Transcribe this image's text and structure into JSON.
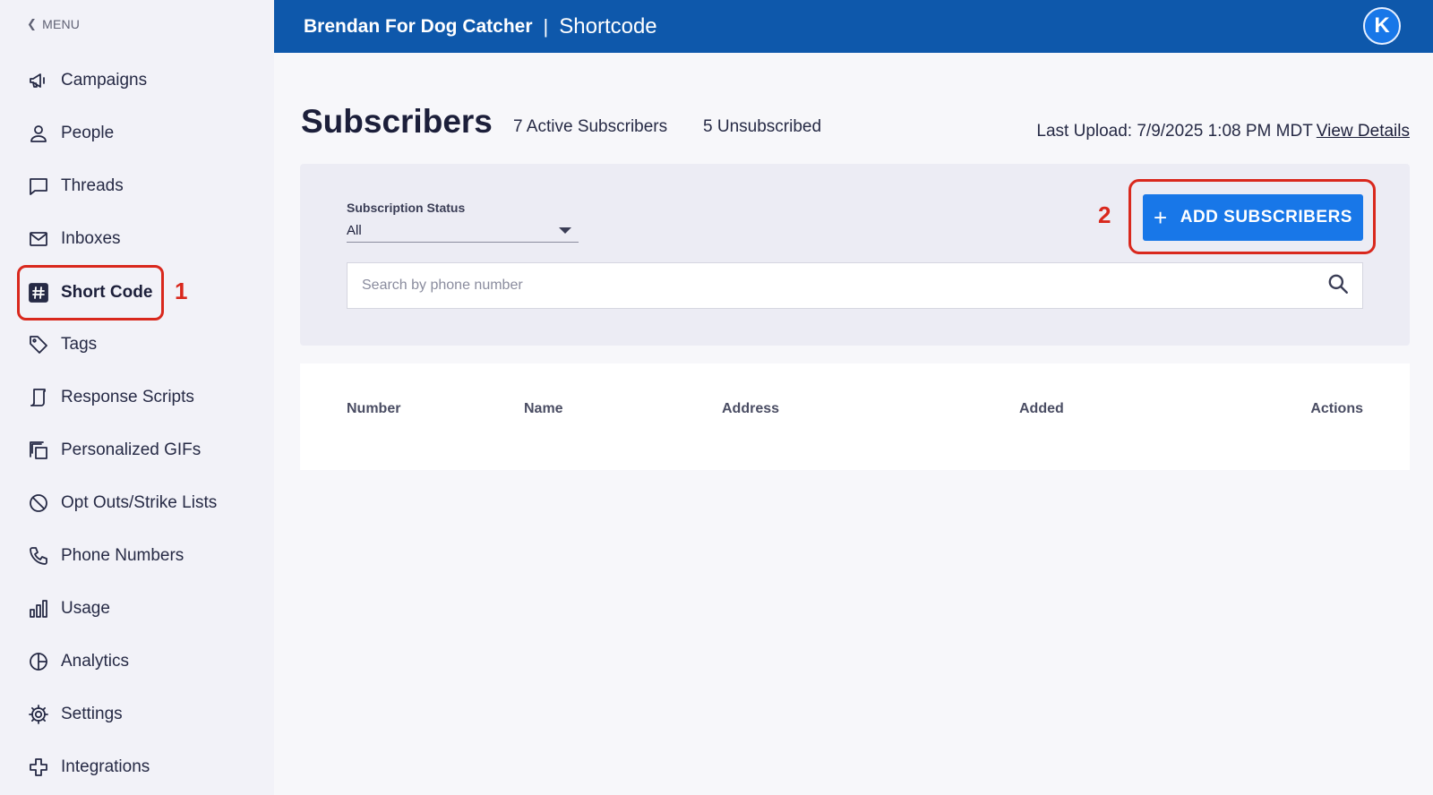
{
  "sidebar": {
    "back_label": "MENU",
    "items": [
      {
        "label": "Campaigns",
        "icon": "megaphone-icon"
      },
      {
        "label": "People",
        "icon": "person-icon"
      },
      {
        "label": "Threads",
        "icon": "chat-icon"
      },
      {
        "label": "Inboxes",
        "icon": "envelope-icon"
      },
      {
        "label": "Short Code",
        "icon": "hash-icon",
        "active": true
      },
      {
        "label": "Tags",
        "icon": "tag-icon"
      },
      {
        "label": "Response Scripts",
        "icon": "script-icon"
      },
      {
        "label": "Personalized GIFs",
        "icon": "copy-icon"
      },
      {
        "label": "Opt Outs/Strike Lists",
        "icon": "ban-icon"
      },
      {
        "label": "Phone Numbers",
        "icon": "phone-icon"
      },
      {
        "label": "Usage",
        "icon": "bar-chart-icon"
      },
      {
        "label": "Analytics",
        "icon": "pie-chart-icon"
      },
      {
        "label": "Settings",
        "icon": "gear-icon"
      },
      {
        "label": "Integrations",
        "icon": "puzzle-icon"
      }
    ]
  },
  "header": {
    "org_name": "Brendan For Dog Catcher",
    "separator": "|",
    "section": "Shortcode",
    "avatar_initial": "K"
  },
  "main": {
    "title": "Subscribers",
    "active_count": "7 Active Subscribers",
    "unsubscribed_count": "5 Unsubscribed",
    "last_upload": "Last Upload: 7/9/2025 1:08 PM MDT",
    "view_details": "View Details",
    "filter": {
      "status_label": "Subscription Status",
      "status_value": "All",
      "search_placeholder": "Search by phone number"
    },
    "add_button": "ADD SUBSCRIBERS",
    "table_columns": [
      "Number",
      "Name",
      "Address",
      "Added",
      "Actions"
    ]
  },
  "annotations": {
    "step1": "1",
    "step2": "2"
  },
  "colors": {
    "header_bg": "#0e58ab",
    "primary_button": "#1877e8",
    "highlight": "#d9281d"
  }
}
